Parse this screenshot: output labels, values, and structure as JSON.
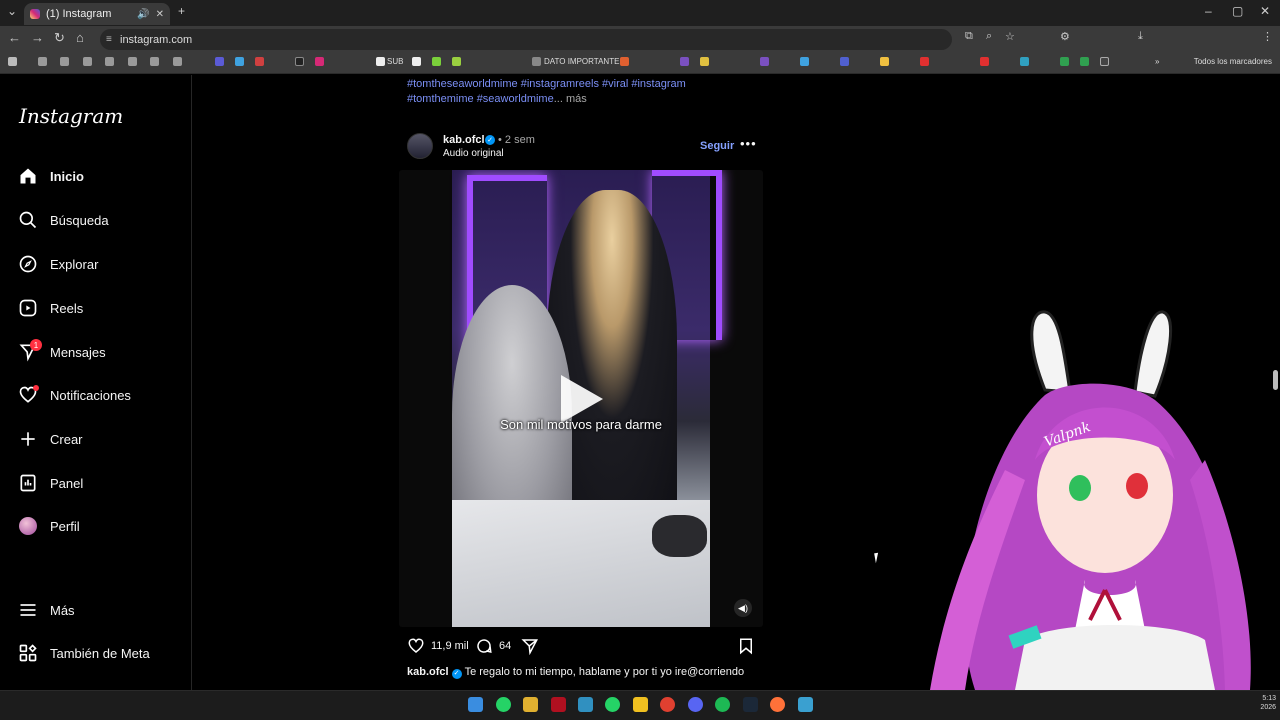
{
  "browser": {
    "tab_title": "(1) Instagram",
    "url": "instagram.com",
    "bookmarks": [
      "SUB",
      "DATO IMPORTANTE"
    ],
    "all_bookmarks": "Todos los marcadores"
  },
  "sidebar": {
    "logo": "Instagram",
    "items": [
      {
        "label": "Inicio",
        "icon": "home-icon"
      },
      {
        "label": "Búsqueda",
        "icon": "search-icon"
      },
      {
        "label": "Explorar",
        "icon": "compass-icon"
      },
      {
        "label": "Reels",
        "icon": "reels-icon"
      },
      {
        "label": "Mensajes",
        "icon": "messenger-icon",
        "badge": "1"
      },
      {
        "label": "Notificaciones",
        "icon": "heart-icon"
      },
      {
        "label": "Crear",
        "icon": "plus-icon"
      },
      {
        "label": "Panel",
        "icon": "dashboard-icon"
      },
      {
        "label": "Perfil",
        "icon": "avatar"
      },
      {
        "label": "Más",
        "icon": "menu-icon"
      },
      {
        "label": "También de Meta",
        "icon": "meta-apps-icon"
      }
    ]
  },
  "previous_post": {
    "hashtags_line1": "#tomtheseaworldmime #instagramreels #viral #instagram",
    "hashtags_line2": "#tomthemime #seaworldmime",
    "more": "... más"
  },
  "post": {
    "username": "kab.ofcl",
    "time": "• 2 sem",
    "audio": "Audio original",
    "follow": "Seguir",
    "options": "•••",
    "video_caption": "Son mil motivos para darme",
    "likes": "11,9 mil",
    "comments": "64",
    "caption_user": "kab.ofcl",
    "caption_text": "Te regalo to mi tiempo, hablame y por ti yo ire@corriendo"
  },
  "overlay": {
    "vtuber_label": "Valpnk"
  },
  "clock": {
    "time": "5:13",
    "date": "2026"
  },
  "colors": {
    "accent_blue": "#0095f6",
    "follow_blue": "#85a1ff",
    "badge_red": "#ff3040",
    "hashtag": "#7b8ff5"
  }
}
